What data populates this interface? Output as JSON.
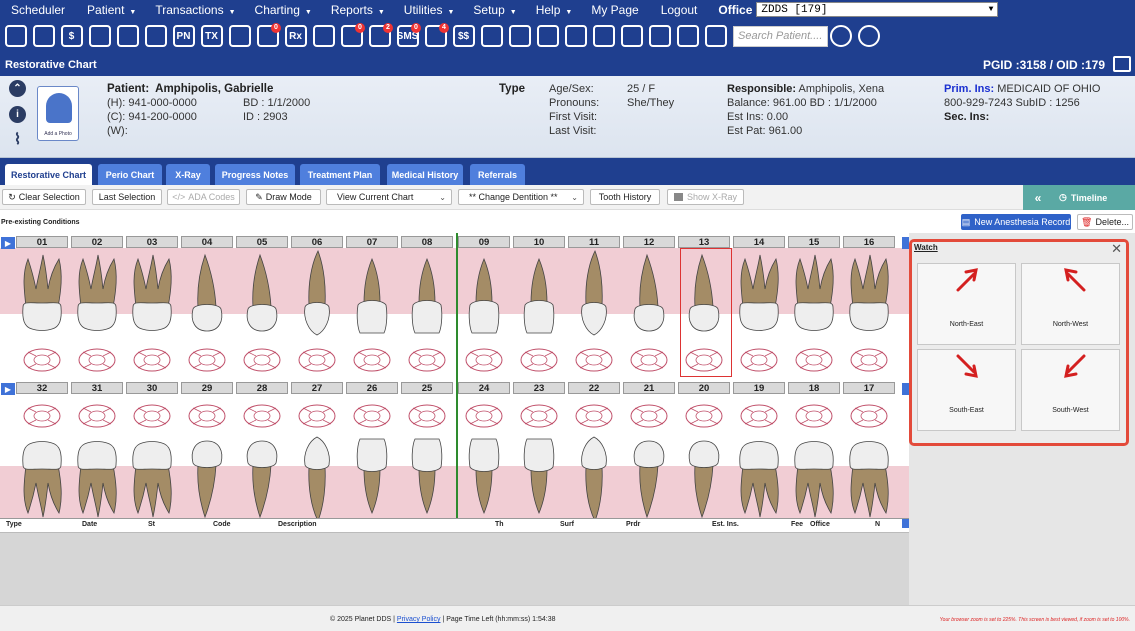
{
  "menubar": {
    "items": [
      "Scheduler",
      "Patient",
      "Transactions",
      "Charting",
      "Reports",
      "Utilities",
      "Setup",
      "Help",
      "My Page",
      "Logout"
    ],
    "has_caret": [
      false,
      true,
      true,
      true,
      true,
      true,
      true,
      true,
      false,
      false
    ],
    "office_label": "Office",
    "office_value": "ZDDS [179]"
  },
  "iconbar": {
    "icons": [
      "home-icon",
      "calendar-icon",
      "dollar-icon",
      "pen-icon",
      "tooth-icon",
      "tooth-alt-icon",
      "pn-icon",
      "tx-icon",
      "add-person-icon",
      "globe-icon",
      "rx-icon",
      "note-icon",
      "message-icon",
      "notes-icon",
      "sms-icon",
      "refresh-icon",
      "dollar-shield-icon",
      "network-icon",
      "chart-line-icon",
      "globe-alt-icon",
      "megaphone-icon",
      "printer-icon",
      "document-icon",
      "check-shield-icon",
      "shield-arrow-icon",
      "chevron-shield-icon"
    ],
    "badges": {
      "globe-icon": "0",
      "message-icon": "0",
      "notes-icon": "2",
      "sms-icon": "0",
      "refresh-icon": "4"
    },
    "icon_text": {
      "pn-icon": "PN",
      "tx-icon": "TX",
      "rx-icon": "Rx",
      "sms-icon": "SMS",
      "dollar-icon": "$",
      "dollar-shield-icon": "$$"
    },
    "search_placeholder": "Search Patient...."
  },
  "title": {
    "text": "Restorative Chart",
    "pgid": "PGID :3158  /  OID :179"
  },
  "patient": {
    "label": "Patient:",
    "name": "Amphipolis, Gabrielle",
    "home": "(H):  941-000-0000",
    "cell": "(C):  941-200-0000",
    "work": "(W):",
    "bd": "BD  :  1/1/2000",
    "id": "ID  :  2903",
    "type_label": "Type",
    "age_sex_label": "Age/Sex:",
    "age_sex": "25 / F",
    "pronouns_label": "Pronouns:",
    "pronouns": "She/They",
    "first_visit_label": "First Visit:",
    "last_visit_label": "Last Visit:",
    "responsible_label": "Responsible:",
    "responsible": "Amphipolis, Xena",
    "balance": "Balance:  961.00     BD  :  1/1/2000",
    "est_ins": "Est Ins:   0.00",
    "est_pat": "Est Pat:  961.00",
    "prim_ins_label": "Prim. Ins:",
    "prim_ins": "MEDICAID OF OHIO",
    "ins_phone": "800-929-7243  SubID  :  1256",
    "sec_ins_label": "Sec. Ins:",
    "photo_caption": "Add a Photo"
  },
  "tabs": [
    "Restorative Chart",
    "Perio Chart",
    "X-Ray",
    "Progress Notes",
    "Treatment Plan",
    "Medical History",
    "Referrals"
  ],
  "toolbar": {
    "clear_selection": "Clear Selection",
    "last_selection": "Last Selection",
    "ada_codes": "ADA Codes",
    "draw_mode": "Draw Mode",
    "view_current_chart": "View Current Chart",
    "change_dentition": "** Change Dentition **",
    "tooth_history": "Tooth History",
    "show_xray": "Show X-Ray",
    "timeline": "Timeline"
  },
  "subbar": {
    "preexisting": "Pre-existing Conditions",
    "new_anesthesia": "New Anesthesia Record",
    "delete": "Delete..."
  },
  "teeth": {
    "upper": [
      "01",
      "02",
      "03",
      "04",
      "05",
      "06",
      "07",
      "08",
      "09",
      "10",
      "11",
      "12",
      "13",
      "14",
      "15",
      "16"
    ],
    "lower": [
      "32",
      "31",
      "30",
      "29",
      "28",
      "27",
      "26",
      "25",
      "24",
      "23",
      "22",
      "21",
      "20",
      "19",
      "18",
      "17"
    ],
    "selected": "13"
  },
  "grid_headers": [
    "Type",
    "Date",
    "St",
    "Code",
    "Description",
    "Th",
    "Surf",
    "Prdr",
    "Est. Ins.",
    "Fee",
    "Office",
    "N"
  ],
  "watch": {
    "title": "Watch",
    "cells": [
      "North-East",
      "North-West",
      "South-East",
      "South-West"
    ]
  },
  "footer": {
    "copyright": "© 2025 Planet DDS | ",
    "privacy": "Privacy Policy",
    "time_left": " | Page Time Left (hh:mm:ss) 1:54:38",
    "zoom_note": "Your browser zoom is set to 225%. This screen is best viewed, if zoom is set to 100%."
  },
  "colors": {
    "nav": "#1f3f8f",
    "tab": "#4f7fdd",
    "gum": "#f1cdd4",
    "watch_border": "#e34a3a",
    "arrow": "#d42020"
  }
}
